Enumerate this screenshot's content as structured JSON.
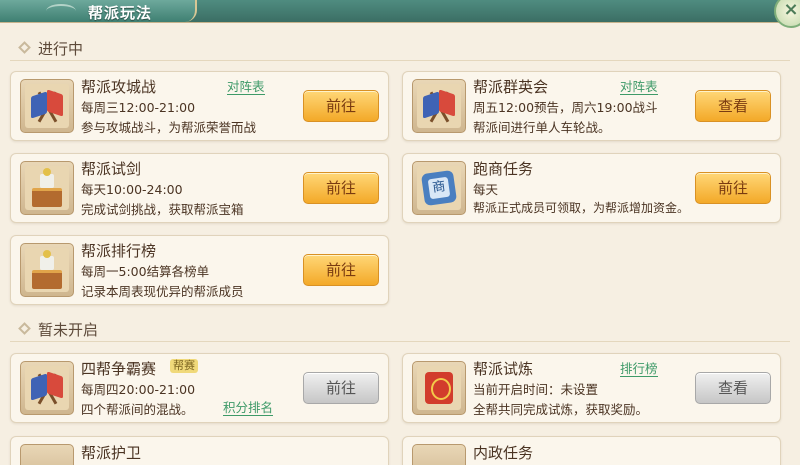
{
  "window": {
    "title": "帮派玩法",
    "close_icon": "close-icon"
  },
  "colors": {
    "accent_green": "#3e9a68",
    "button_orange": "#f3a928",
    "button_gray": "#c6c6c6"
  },
  "sections": {
    "active": {
      "label": "进行中"
    },
    "inactive": {
      "label": "暂未开启"
    }
  },
  "cards": {
    "siege": {
      "name": "帮派攻城战",
      "line1": "每周三12:00-21:00",
      "line2": "参与攻城战斗，为帮派荣誉而战",
      "link": "对阵表",
      "button": "前往",
      "icon": "flags-icon"
    },
    "heroes": {
      "name": "帮派群英会",
      "line1": "周五12:00预告，周六19:00战斗",
      "line2": "帮派间进行单人车轮战。",
      "link": "对阵表",
      "button": "查看",
      "icon": "flags-icon"
    },
    "trial_sword": {
      "name": "帮派试剑",
      "line1": "每天10:00-24:00",
      "line2": "完成试剑挑战，获取帮派宝箱",
      "button": "前往",
      "icon": "treasure-chest-icon"
    },
    "merchant": {
      "name": "跑商任务",
      "line1": "每天",
      "line2": "帮派正式成员可领取，为帮派增加资金。",
      "button": "前往",
      "icon": "merchant-bag-icon",
      "icon_text": "商"
    },
    "ranking": {
      "name": "帮派排行榜",
      "line1": "每周一5:00结算各榜单",
      "line2": "记录本周表现优异的帮派成员",
      "button": "前往",
      "icon": "treasure-chest-icon"
    },
    "four_gang": {
      "name": "四帮争霸赛",
      "badge": "帮赛",
      "line1": "每周四20:00-21:00",
      "line2": "四个帮派间的混战。",
      "link": "积分排名",
      "button": "前往",
      "icon": "flags-icon"
    },
    "trial": {
      "name": "帮派试炼",
      "line1": "当前开启时间：未设置",
      "line2": "全帮共同完成试炼，获取奖励。",
      "link": "排行榜",
      "button": "查看",
      "icon": "scroll-icon"
    },
    "defense": {
      "name": "帮派护卫"
    },
    "internal": {
      "name": "内政任务"
    }
  }
}
